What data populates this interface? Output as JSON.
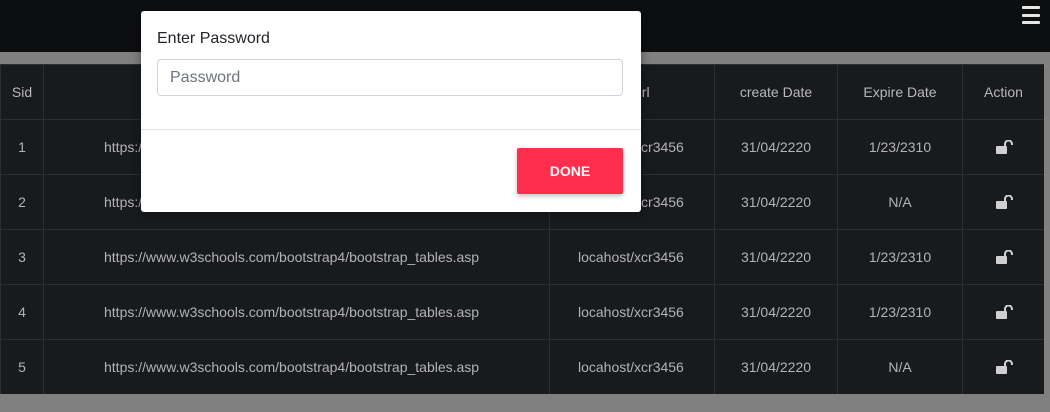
{
  "modal": {
    "label": "Enter Password",
    "input_placeholder": "Password",
    "input_value": "",
    "done_label": "DONE"
  },
  "table": {
    "headers": [
      "Sid",
      "",
      "url",
      "create Date",
      "Expire Date",
      "Action"
    ],
    "rows": [
      {
        "sid": "1",
        "link": "https://www.w3schools.com/bootstrap4/bootstrap_tables.asp",
        "url": "locahost/xcr3456",
        "create": "31/04/2220",
        "expire": "1/23/2310",
        "action_icon": "unlock-icon"
      },
      {
        "sid": "2",
        "link": "https://www.w3schools.com/bootstrap4/bootstrap_tables.asp",
        "url": "locahost/xcr3456",
        "create": "31/04/2220",
        "expire": "N/A",
        "action_icon": "unlock-icon"
      },
      {
        "sid": "3",
        "link": "https://www.w3schools.com/bootstrap4/bootstrap_tables.asp",
        "url": "locahost/xcr3456",
        "create": "31/04/2220",
        "expire": "1/23/2310",
        "action_icon": "unlock-icon"
      },
      {
        "sid": "4",
        "link": "https://www.w3schools.com/bootstrap4/bootstrap_tables.asp",
        "url": "locahost/xcr3456",
        "create": "31/04/2220",
        "expire": "1/23/2310",
        "action_icon": "unlock-icon"
      },
      {
        "sid": "5",
        "link": "https://www.w3schools.com/bootstrap4/bootstrap_tables.asp",
        "url": "locahost/xcr3456",
        "create": "31/04/2220",
        "expire": "N/A",
        "action_icon": "unlock-icon"
      }
    ]
  },
  "navbar": {
    "menu_icon": "hamburger-menu-icon"
  },
  "colors": {
    "accent": "#ff2e4d",
    "table_bg": "#181a1d",
    "navbar_bg": "#0d0e10"
  }
}
